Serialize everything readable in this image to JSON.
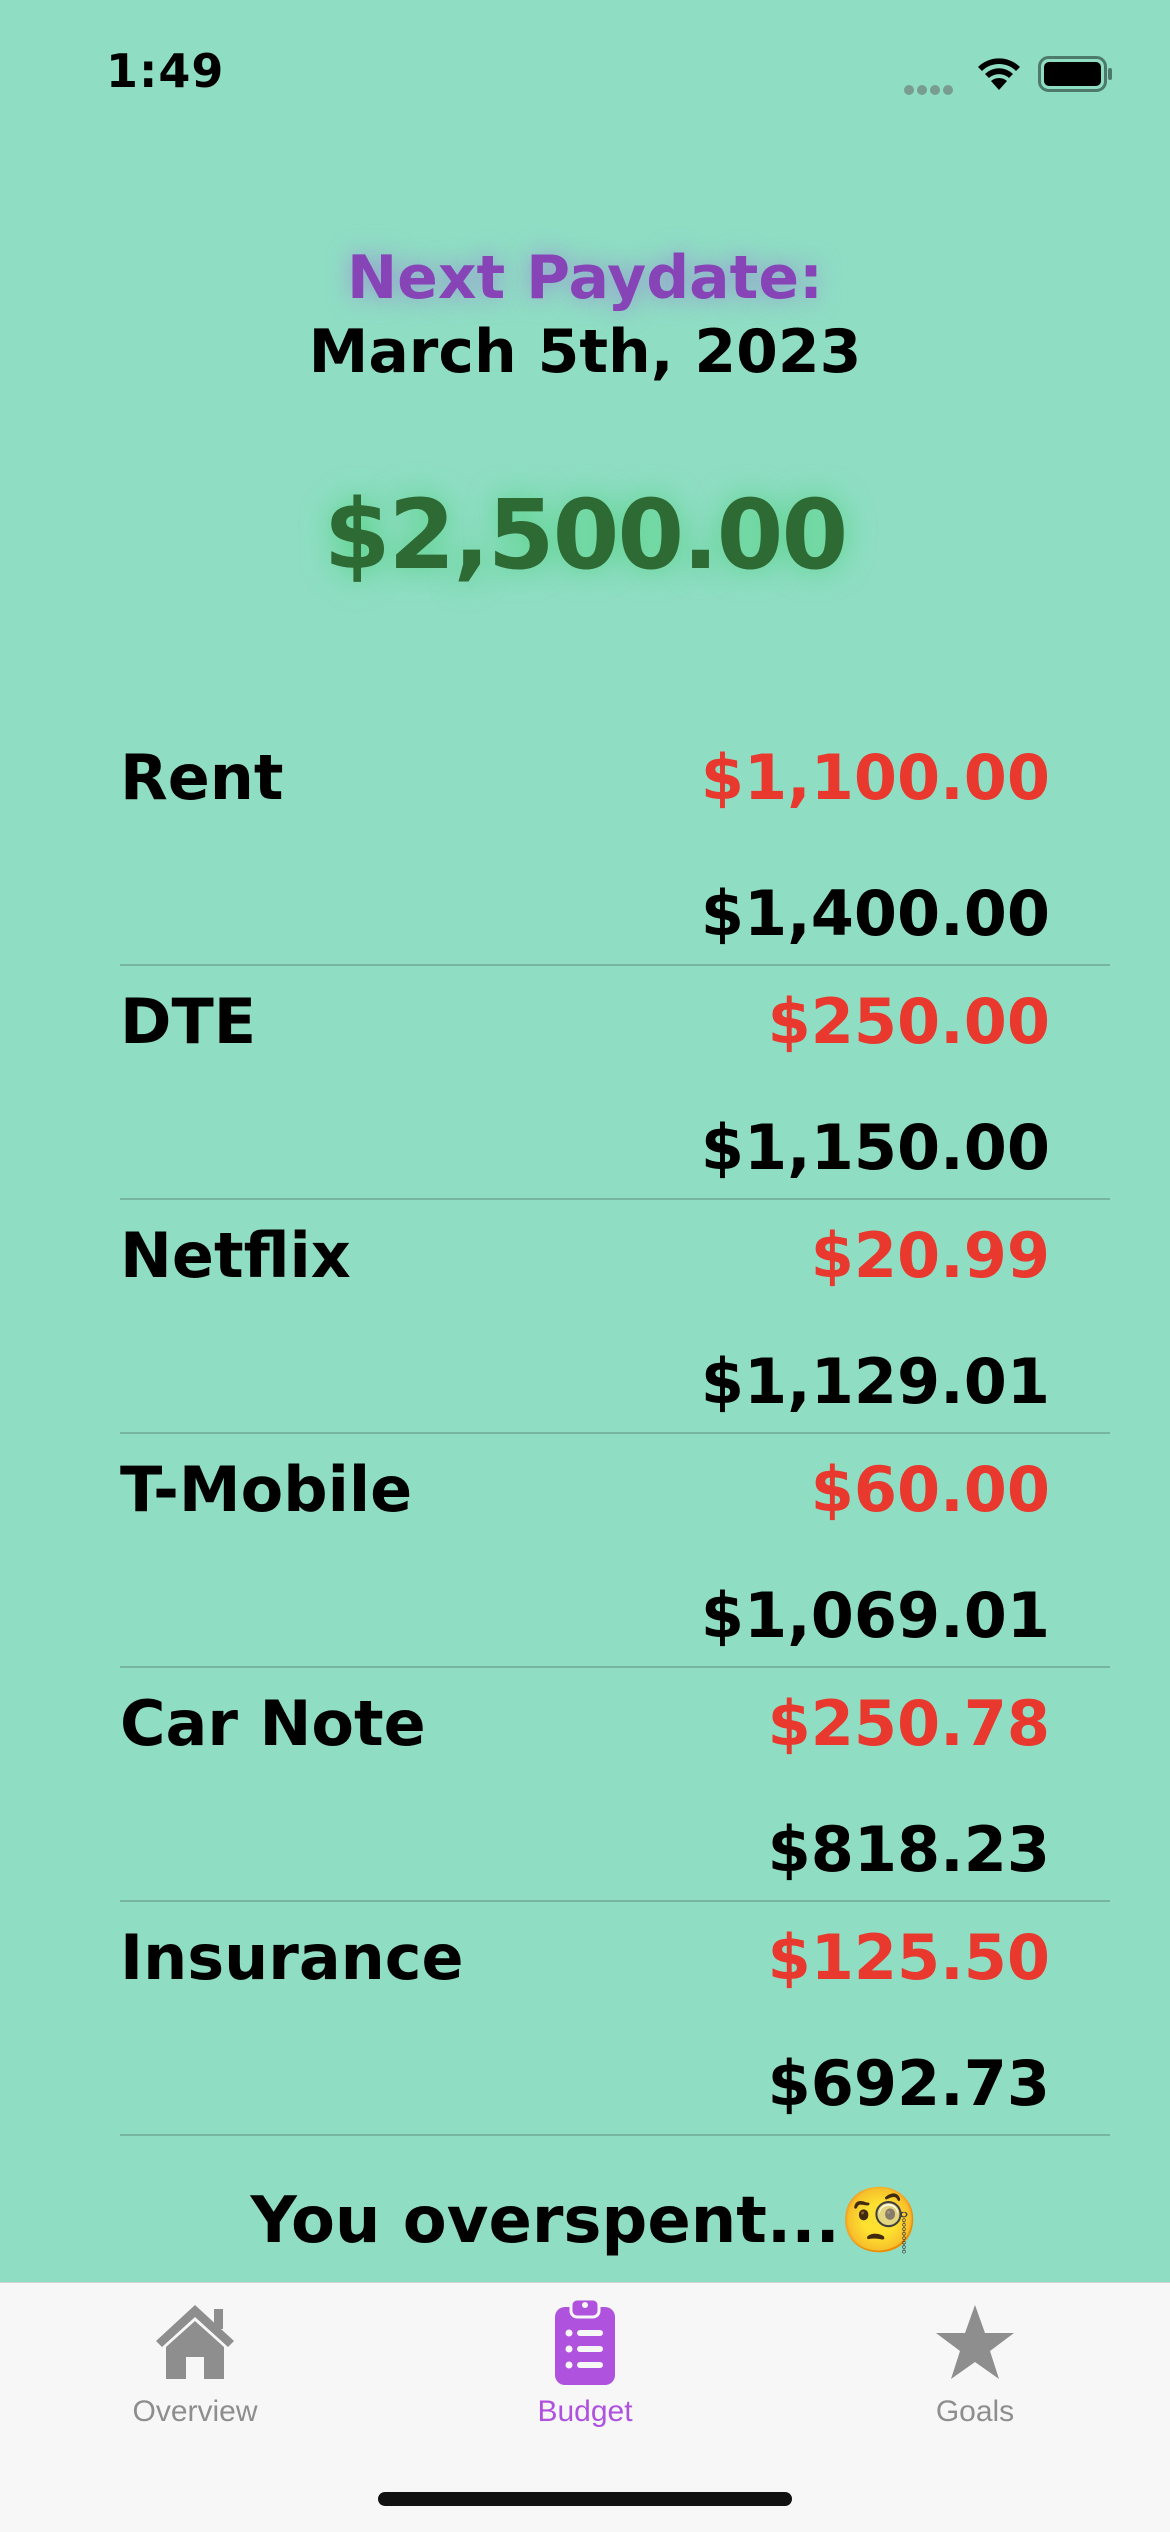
{
  "status": {
    "time": "1:49"
  },
  "header": {
    "paydate_label": "Next Paydate:",
    "paydate_value": "March 5th, 2023",
    "balance": "$2,500.00"
  },
  "bills": [
    {
      "name": "Rent",
      "amount": "$1,100.00",
      "remaining": "$1,400.00"
    },
    {
      "name": "DTE",
      "amount": "$250.00",
      "remaining": "$1,150.00"
    },
    {
      "name": "Netflix",
      "amount": "$20.99",
      "remaining": "$1,129.01"
    },
    {
      "name": "T-Mobile",
      "amount": "$60.00",
      "remaining": "$1,069.01"
    },
    {
      "name": "Car Note",
      "amount": "$250.78",
      "remaining": "$818.23"
    },
    {
      "name": "Insurance",
      "amount": "$125.50",
      "remaining": "$692.73"
    }
  ],
  "footer": {
    "message": "You overspent...🧐"
  },
  "tabs": [
    {
      "label": "Overview",
      "icon": "house-icon",
      "active": false
    },
    {
      "label": "Budget",
      "icon": "clipboard-list-icon",
      "active": true
    },
    {
      "label": "Goals",
      "icon": "star-icon",
      "active": false
    }
  ],
  "colors": {
    "background": "#8FDEC4",
    "accent": "#AF52DE",
    "paydate_label": "#8744B7",
    "balance": "#2E6A34",
    "expense": "#E9392E"
  }
}
